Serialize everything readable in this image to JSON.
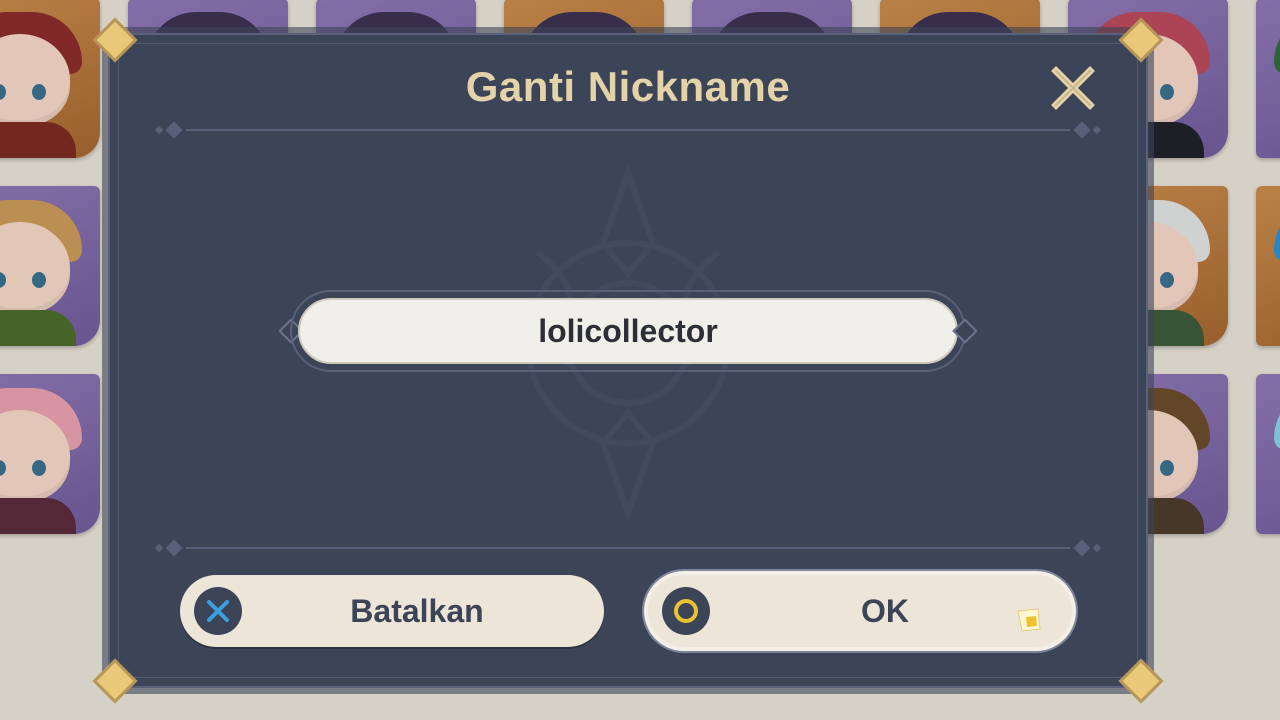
{
  "dialog": {
    "title": "Ganti Nickname",
    "close_icon": "close-icon"
  },
  "nickname": {
    "value": "lolicollector"
  },
  "buttons": {
    "cancel_label": "Batalkan",
    "cancel_icon": "x-button-icon",
    "ok_label": "OK",
    "ok_icon": "circle-button-icon"
  },
  "colors": {
    "dialog_bg": "#3c4457",
    "title": "#e4d3a9",
    "button_bg": "#ece5d8",
    "cancel_icon": "#3aa0e0",
    "ok_icon": "#e9c133"
  }
}
